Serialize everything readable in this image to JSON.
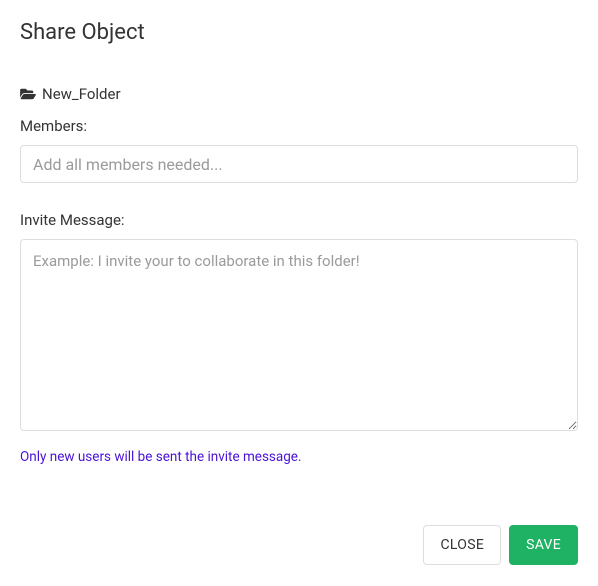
{
  "header": {
    "title": "Share Object"
  },
  "folder": {
    "icon": "folder-open-icon",
    "name": "New_Folder"
  },
  "members": {
    "label": "Members:",
    "placeholder": "Add all members needed...",
    "value": ""
  },
  "invite": {
    "label": "Invite Message:",
    "placeholder": "Example: I invite your to collaborate in this folder!",
    "value": ""
  },
  "notice": "Only new users will be sent the invite message.",
  "buttons": {
    "close": "CLOSE",
    "save": "SAVE"
  },
  "colors": {
    "accent_green": "#1fb264",
    "notice_purple": "#4a12d6",
    "border": "#dddddd"
  }
}
